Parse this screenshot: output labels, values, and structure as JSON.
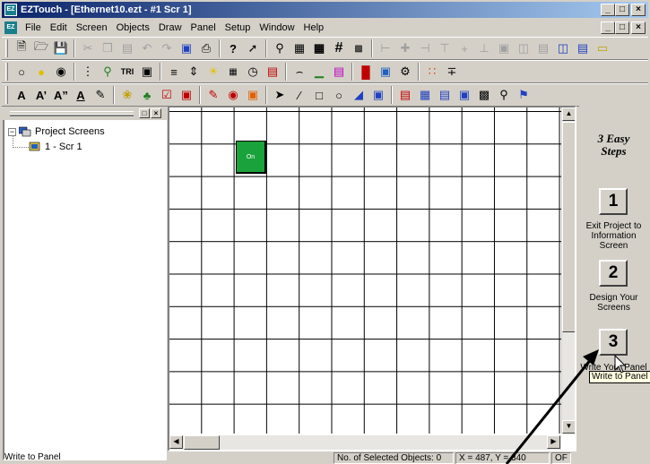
{
  "window": {
    "title": "EZTouch - [Ethernet10.ezt - #1 Scr 1]",
    "app_icon": "EZ",
    "min_label": "_",
    "max_label": "□",
    "close_label": "×"
  },
  "menubar": {
    "items": [
      "File",
      "Edit",
      "Screen",
      "Objects",
      "Draw",
      "Panel",
      "Setup",
      "Window",
      "Help"
    ],
    "mnemonics": [
      "F",
      "E",
      "S",
      "O",
      "D",
      "P",
      "u",
      "W",
      "H"
    ]
  },
  "toolbars": {
    "row1": [
      "new-icon",
      "open-icon",
      "save-icon",
      "cut-icon",
      "copy-icon",
      "paste-icon",
      "undo-icon",
      "redo-icon",
      "preview-icon",
      "print-icon",
      "help-icon",
      "context-help-icon",
      "zoom-icon",
      "grid-icon",
      "grid-bold-icon",
      "grid-hash-icon",
      "snap-icon",
      "align-left-icon",
      "align-center-icon",
      "align-right-icon",
      "align-top-icon",
      "align-middle-icon",
      "align-bottom-icon",
      "same-size-icon",
      "same-width-icon",
      "same-height-icon",
      "tile-icon",
      "cascade-icon",
      "tag-icon"
    ],
    "row2": [
      "lamp-icon",
      "indicator-icon",
      "multistate-icon",
      "thermometer-icon",
      "dial-icon",
      "tri-icon",
      "display-icon",
      "bargraph-icon",
      "thumbwheel-icon",
      "light-icon",
      "numeric-icon",
      "clock-icon",
      "message-icon",
      "meter-icon",
      "chart-icon",
      "graph-icon",
      "stacked-icon",
      "picture-icon",
      "recipe-icon",
      "pushbutton-icon",
      "slider-icon"
    ],
    "row3": [
      "text-icon",
      "large-text-icon",
      "dynamic-text-icon",
      "ascii-icon",
      "bitmap-icon",
      "goto-icon",
      "toggle-icon",
      "checkbox-icon",
      "alarm-icon",
      "scheduler-icon",
      "gauge-icon",
      "palette-icon",
      "pointer-icon",
      "line-icon",
      "rectangle-icon",
      "ellipse-icon",
      "fill-icon",
      "frame-icon",
      "popup-icon",
      "info-icon",
      "list-icon",
      "option-icon",
      "pie-icon",
      "lasso-icon",
      "select-icon"
    ],
    "row1_tri_label": "TRI"
  },
  "project_tree": {
    "root": "Project Screens",
    "children": [
      "1 - Scr 1"
    ],
    "expander": "−"
  },
  "canvas": {
    "objects": [
      {
        "label": "On",
        "fill": "#1aa23c"
      }
    ]
  },
  "steps_panel": {
    "title_line1": "3 Easy",
    "title_line2": "Steps",
    "steps": [
      {
        "number": "1",
        "label": "Exit Project to Information Screen"
      },
      {
        "number": "2",
        "label": "Design Your Screens"
      },
      {
        "number": "3",
        "label": "Write Your Panel to Panel"
      }
    ],
    "tooltip": "Write to Panel"
  },
  "statusbar": {
    "message": "Write to Panel",
    "selected": "No. of Selected Objects: 0",
    "coords": "X = 487, Y = 340",
    "mode": "OF"
  },
  "colors": {
    "title_start": "#0a246a",
    "title_end": "#a6caf0",
    "face": "#d4d0c8",
    "on_button": "#1aa23c"
  }
}
